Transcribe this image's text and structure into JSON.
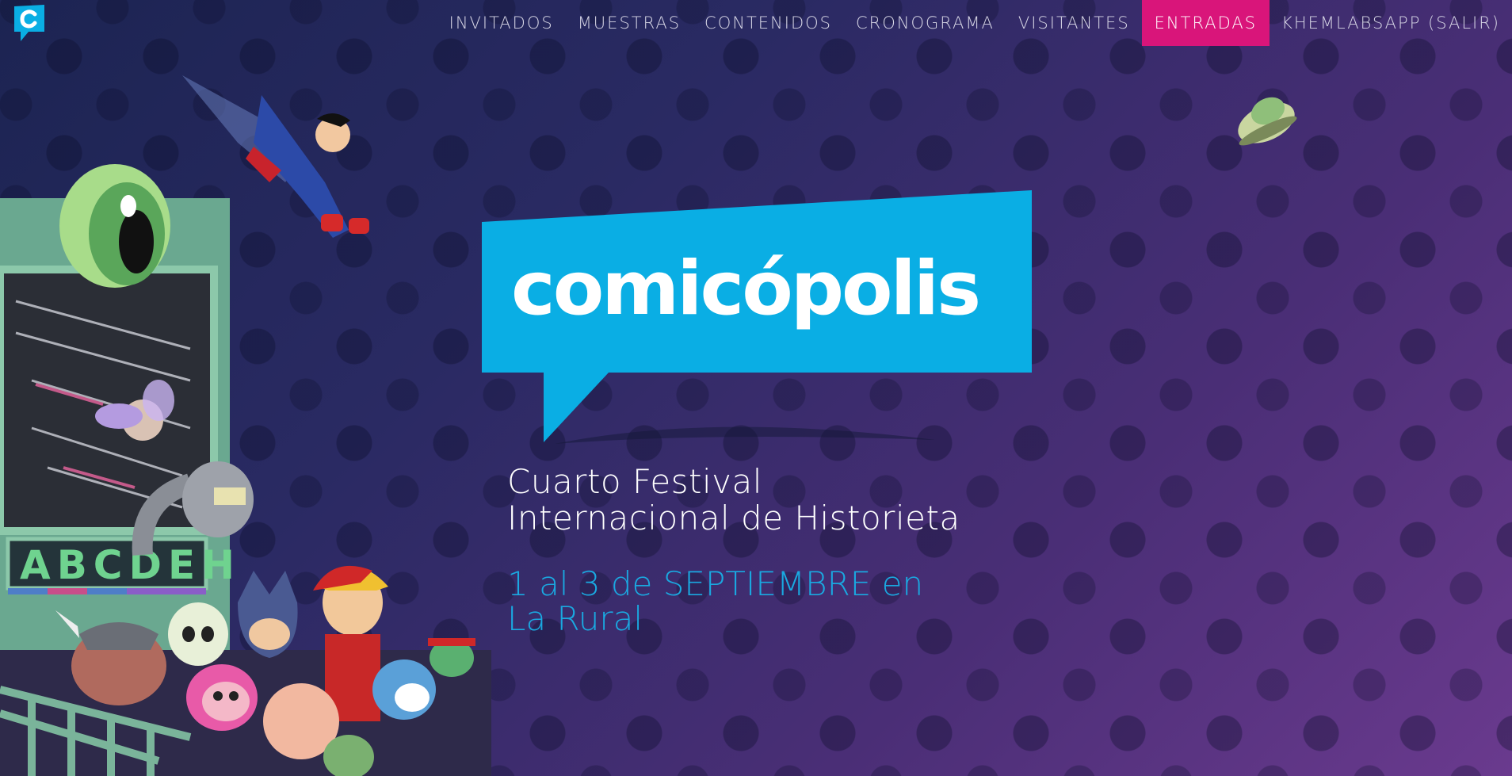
{
  "nav": {
    "items": [
      {
        "label": "INVITADOS"
      },
      {
        "label": "MUESTRAS"
      },
      {
        "label": "CONTENIDOS"
      },
      {
        "label": "CRONOGRAMA"
      },
      {
        "label": "VISITANTES"
      },
      {
        "label": "ENTRADAS"
      },
      {
        "label": "KHEMLABSAPP (SALIR)"
      }
    ]
  },
  "hero": {
    "logo_text": "comicópolis",
    "subtitle_line1": "Cuarto Festival",
    "subtitle_line2": "Internacional de Historieta",
    "dates_line1": "1 al 3 de SEPTIEMBRE en",
    "dates_line2": "La Rural"
  },
  "illustration": {
    "sign_text": "ABCDEH"
  },
  "colors": {
    "accent_pink": "#d9157a",
    "brand_blue": "#0aaee4",
    "date_blue": "#1aa9e1",
    "background_dark": "#1c2452",
    "background_purple": "#6a3a8e"
  }
}
